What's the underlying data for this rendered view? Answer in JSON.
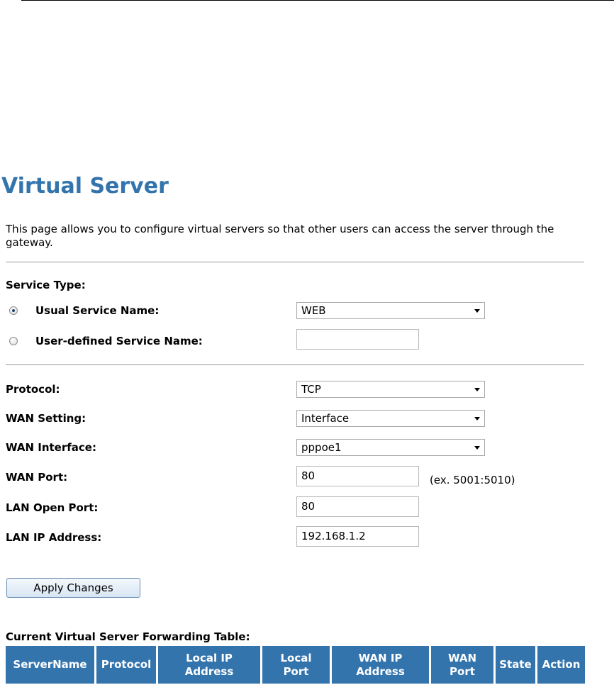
{
  "page": {
    "title": "Virtual Server",
    "description": "This page allows you to configure virtual servers so that other users can access the server through the gateway."
  },
  "service": {
    "section_label": "Service Type:",
    "usual_label": "Usual Service Name:",
    "usual_value": "WEB",
    "usual_selected": true,
    "user_defined_label": "User-defined Service Name:",
    "user_defined_value": ""
  },
  "fields": {
    "protocol_label": "Protocol:",
    "protocol_value": "TCP",
    "wan_setting_label": "WAN Setting:",
    "wan_setting_value": "Interface",
    "wan_interface_label": "WAN Interface:",
    "wan_interface_value": "pppoe1",
    "wan_port_label": "WAN Port:",
    "wan_port_value": "80",
    "wan_port_hint": "(ex. 5001:5010)",
    "lan_open_port_label": "LAN Open Port:",
    "lan_open_port_value": "80",
    "lan_ip_label": "LAN IP Address:",
    "lan_ip_value": "192.168.1.2"
  },
  "actions": {
    "apply_label": "Apply Changes"
  },
  "table": {
    "title": "Current Virtual Server Forwarding Table:",
    "headers": [
      "ServerName",
      "Protocol",
      "Local IP\nAddress",
      "Local\nPort",
      "WAN IP\nAddress",
      "WAN\nPort",
      "State",
      "Action"
    ]
  },
  "colors": {
    "accent": "#3474ad",
    "header_text": "#ffffff"
  }
}
